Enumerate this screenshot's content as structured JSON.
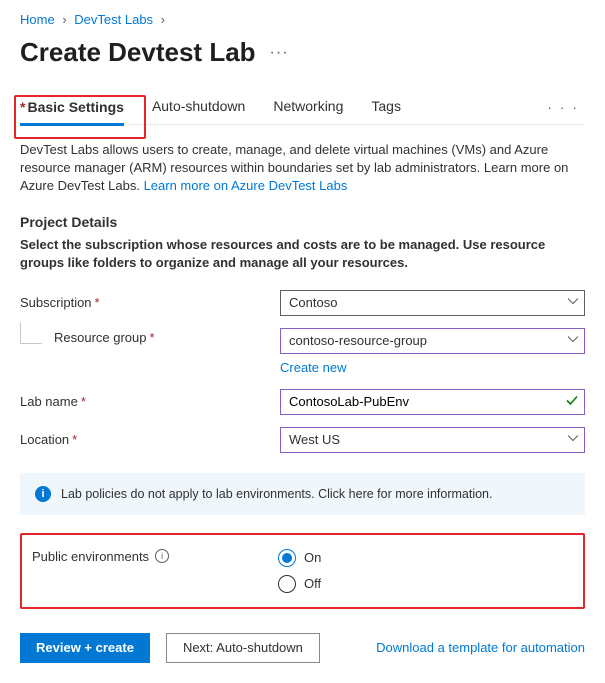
{
  "breadcrumb": {
    "home": "Home",
    "devtest": "DevTest Labs"
  },
  "page_title": "Create Devtest Lab",
  "tabs": {
    "basic": "Basic Settings",
    "auto": "Auto-shutdown",
    "net": "Networking",
    "tags": "Tags"
  },
  "intro_text": "DevTest Labs allows users to create, manage, and delete virtual machines (VMs) and Azure resource manager (ARM) resources within boundaries set by lab administrators. Learn more on Azure DevTest Labs. ",
  "intro_link": "Learn more on Azure DevTest Labs",
  "project": {
    "heading": "Project Details",
    "desc": "Select the subscription whose resources and costs are to be managed. Use resource groups like folders to organize and manage all your resources."
  },
  "form": {
    "subscription_label": "Subscription",
    "subscription_value": "Contoso",
    "rg_label": "Resource group",
    "rg_value": "contoso-resource-group",
    "create_new": "Create new",
    "lab_label": "Lab name",
    "lab_value": "ContosoLab-PubEnv",
    "loc_label": "Location",
    "loc_value": "West US"
  },
  "info_text": "Lab policies do not apply to lab environments. Click here for more information.",
  "public_env": {
    "label": "Public environments",
    "on": "On",
    "off": "Off"
  },
  "footer": {
    "review": "Review + create",
    "next": "Next: Auto-shutdown",
    "download": "Download a template for automation"
  }
}
